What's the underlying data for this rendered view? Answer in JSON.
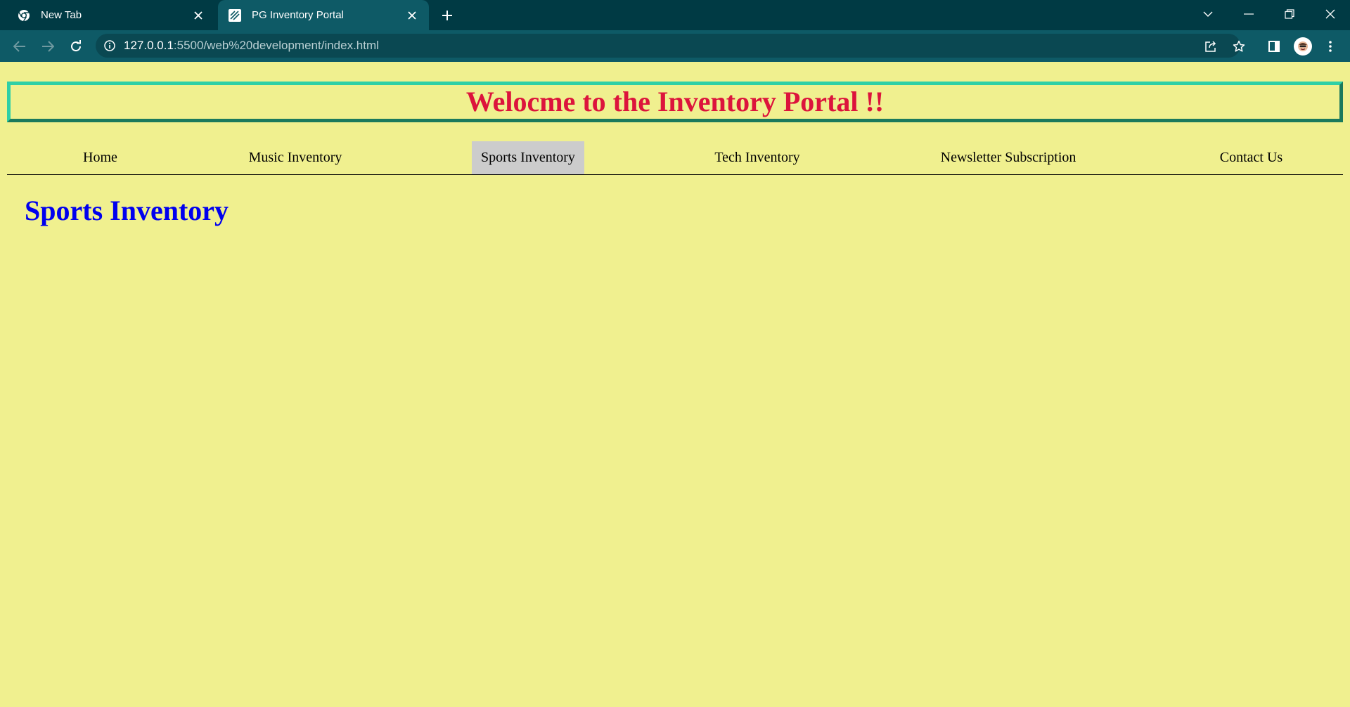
{
  "browser": {
    "tabs": [
      {
        "title": "New Tab",
        "icon": "chrome-icon"
      },
      {
        "title": "PG Inventory Portal",
        "icon": "page-favicon-icon",
        "active": true
      }
    ],
    "address": {
      "host": "127.0.0.1",
      "rest": ":5500/web%20development/index.html"
    }
  },
  "page": {
    "banner_title": "Welocme to the Inventory Portal !!",
    "nav": [
      {
        "label": "Home"
      },
      {
        "label": "Music Inventory"
      },
      {
        "label": "Sports Inventory",
        "active": true
      },
      {
        "label": "Tech Inventory"
      },
      {
        "label": "Newsletter Subscription"
      },
      {
        "label": "Contact Us"
      }
    ],
    "section_title": "Sports Inventory"
  },
  "colors": {
    "page_background": "#f0f08f",
    "banner_text": "#dc143c",
    "section_title": "#0000ee",
    "active_nav_background": "#cccccc",
    "chrome_dark": "#003a44",
    "chrome_toolbar": "#0e5a66"
  }
}
